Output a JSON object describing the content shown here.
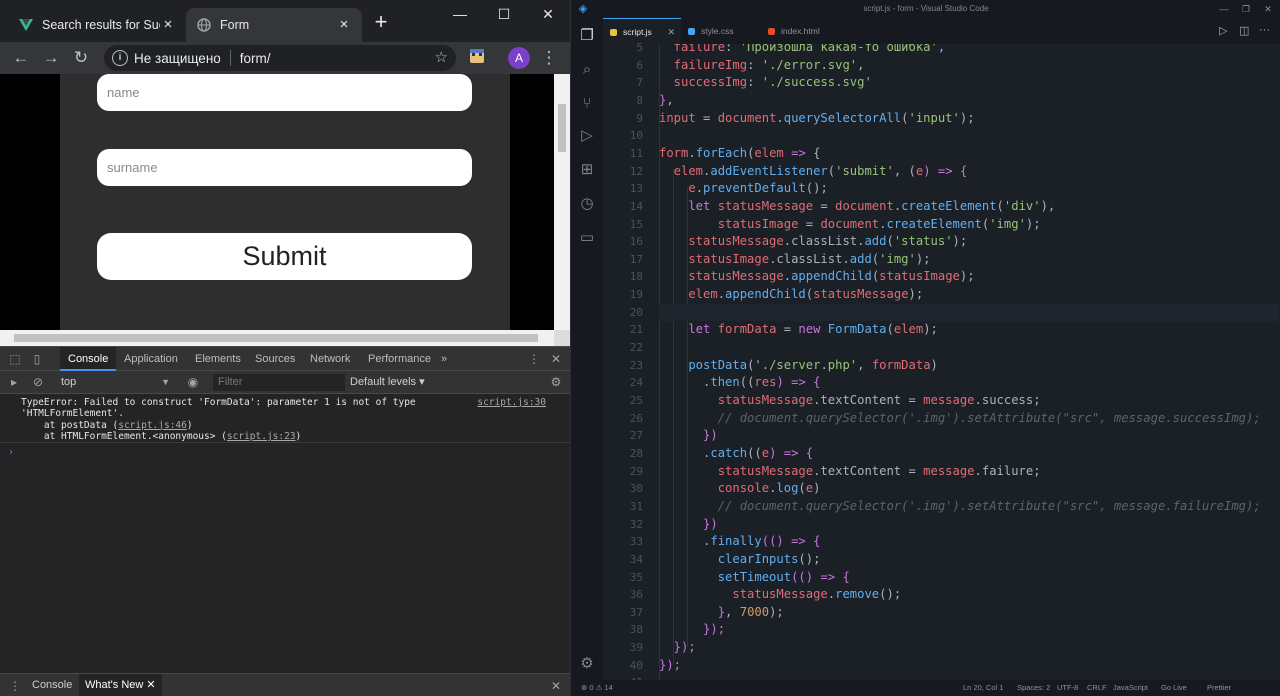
{
  "browser": {
    "tabs": [
      {
        "title": "Search results for Succe",
        "active": false,
        "favicon": "vue-logo-icon"
      },
      {
        "title": "Form",
        "active": true,
        "favicon": "globe-icon"
      }
    ],
    "new_tab": "+",
    "window": {
      "minimize": "—",
      "maximize": "☐",
      "close": "✕"
    },
    "address": {
      "security": "Не защищено",
      "url": "form/"
    },
    "avatar_letter": "A",
    "page": {
      "name_placeholder": "name",
      "surname_placeholder": "surname",
      "submit_label": "Submit"
    }
  },
  "devtools": {
    "tabs": [
      "Console",
      "Application",
      "Elements",
      "Sources",
      "Network",
      "Performance"
    ],
    "more": "»",
    "context": "top",
    "filter_placeholder": "Filter",
    "levels": "Default levels ▾",
    "error": {
      "line1": "TypeError: Failed to construct 'FormData': parameter 1 is not of type",
      "line2": "'HTMLFormElement'.",
      "line3_prefix": "    at postData (",
      "line3_link": "script.js:46",
      "line3_suffix": ")",
      "line4_prefix": "    at HTMLFormElement.<anonymous> (",
      "line4_link": "script.js:23",
      "line4_suffix": ")",
      "source": "script.js:30"
    },
    "prompt": "›",
    "drawer_tabs": [
      "Console",
      "What's New"
    ]
  },
  "vscode": {
    "title": "script.js - form - Visual Studio Code",
    "tabs": [
      {
        "name": "script.js",
        "color": "#e8c33a",
        "active": true
      },
      {
        "name": "style.css",
        "color": "#42a5f5",
        "active": false
      },
      {
        "name": "index.html",
        "color": "#e44d26",
        "active": false
      }
    ],
    "first_line_number": 5,
    "code_lines": [
      [
        [
          "  failure",
          "t-var"
        ],
        [
          ": ",
          "t-pun"
        ],
        [
          "'Произошла какая-то ошибка'",
          "t-str"
        ],
        [
          ",",
          "t-pun"
        ]
      ],
      [
        [
          "  failureImg",
          "t-var"
        ],
        [
          ": ",
          "t-pun"
        ],
        [
          "'./error.svg'",
          "t-str"
        ],
        [
          ",",
          "t-pun"
        ]
      ],
      [
        [
          "  successImg",
          "t-var"
        ],
        [
          ": ",
          "t-pun"
        ],
        [
          "'./success.svg'",
          "t-str"
        ]
      ],
      [
        [
          "}",
          "t-kw"
        ],
        [
          ",",
          "t-pun"
        ]
      ],
      [
        [
          "input",
          "t-var"
        ],
        [
          " = ",
          "t-pun"
        ],
        [
          "document",
          "t-var"
        ],
        [
          ".",
          "t-pun"
        ],
        [
          "querySelectorAll",
          "t-fn"
        ],
        [
          "(",
          "t-pun"
        ],
        [
          "'input'",
          "t-str"
        ],
        [
          ");",
          "t-pun"
        ]
      ],
      [],
      [
        [
          "form",
          "t-var"
        ],
        [
          ".",
          "t-pun"
        ],
        [
          "forEach",
          "t-fn"
        ],
        [
          "(",
          "t-pun"
        ],
        [
          "elem",
          "t-var"
        ],
        [
          " => ",
          "t-kw"
        ],
        [
          "{",
          "t-pun"
        ]
      ],
      [
        [
          "  elem",
          "t-var"
        ],
        [
          ".",
          "t-pun"
        ],
        [
          "addEventListener",
          "t-fn"
        ],
        [
          "(",
          "t-pun"
        ],
        [
          "'submit'",
          "t-str"
        ],
        [
          ", (",
          "t-pun"
        ],
        [
          "e",
          "t-var"
        ],
        [
          ") => {",
          "t-kw"
        ]
      ],
      [
        [
          "    e",
          "t-var"
        ],
        [
          ".",
          "t-pun"
        ],
        [
          "preventDefault",
          "t-fn"
        ],
        [
          "();",
          "t-pun"
        ]
      ],
      [
        [
          "    let ",
          "t-kw"
        ],
        [
          "statusMessage",
          "t-var"
        ],
        [
          " = ",
          "t-pun"
        ],
        [
          "document",
          "t-var"
        ],
        [
          ".",
          "t-pun"
        ],
        [
          "createElement",
          "t-fn"
        ],
        [
          "(",
          "t-pun"
        ],
        [
          "'div'",
          "t-str"
        ],
        [
          "),",
          "t-pun"
        ]
      ],
      [
        [
          "        statusImage",
          "t-var"
        ],
        [
          " = ",
          "t-pun"
        ],
        [
          "document",
          "t-var"
        ],
        [
          ".",
          "t-pun"
        ],
        [
          "createElement",
          "t-fn"
        ],
        [
          "(",
          "t-pun"
        ],
        [
          "'img'",
          "t-str"
        ],
        [
          ");",
          "t-pun"
        ]
      ],
      [
        [
          "    statusMessage",
          "t-var"
        ],
        [
          ".classList.",
          "t-pun"
        ],
        [
          "add",
          "t-fn"
        ],
        [
          "(",
          "t-pun"
        ],
        [
          "'status'",
          "t-str"
        ],
        [
          ");",
          "t-pun"
        ]
      ],
      [
        [
          "    statusImage",
          "t-var"
        ],
        [
          ".classList.",
          "t-pun"
        ],
        [
          "add",
          "t-fn"
        ],
        [
          "(",
          "t-pun"
        ],
        [
          "'img'",
          "t-str"
        ],
        [
          ");",
          "t-pun"
        ]
      ],
      [
        [
          "    statusMessage",
          "t-var"
        ],
        [
          ".",
          "t-pun"
        ],
        [
          "appendChild",
          "t-fn"
        ],
        [
          "(",
          "t-pun"
        ],
        [
          "statusImage",
          "t-var"
        ],
        [
          ");",
          "t-pun"
        ]
      ],
      [
        [
          "    elem",
          "t-var"
        ],
        [
          ".",
          "t-pun"
        ],
        [
          "appendChild",
          "t-fn"
        ],
        [
          "(",
          "t-pun"
        ],
        [
          "statusMessage",
          "t-var"
        ],
        [
          ");",
          "t-pun"
        ]
      ],
      [],
      [
        [
          "    let ",
          "t-kw"
        ],
        [
          "formData",
          "t-var"
        ],
        [
          " = ",
          "t-pun"
        ],
        [
          "new ",
          "t-kw"
        ],
        [
          "FormData",
          "t-fn"
        ],
        [
          "(",
          "t-pun"
        ],
        [
          "elem",
          "t-var"
        ],
        [
          ");",
          "t-pun"
        ]
      ],
      [],
      [
        [
          "    postData",
          "t-fn"
        ],
        [
          "(",
          "t-pun"
        ],
        [
          "'./server.php'",
          "t-str"
        ],
        [
          ", ",
          "t-pun"
        ],
        [
          "formData",
          "t-var"
        ],
        [
          ")",
          "t-pun"
        ]
      ],
      [
        [
          "      .",
          "t-pun"
        ],
        [
          "then",
          "t-fn"
        ],
        [
          "((",
          "t-pun"
        ],
        [
          "res",
          "t-var"
        ],
        [
          ") => {",
          "t-kw"
        ]
      ],
      [
        [
          "        statusMessage",
          "t-var"
        ],
        [
          ".textContent = ",
          "t-pun"
        ],
        [
          "message",
          "t-var"
        ],
        [
          ".success;",
          "t-pun"
        ]
      ],
      [
        [
          "        // document.querySelector('.img').setAttribute(\"src\", message.successImg);",
          "t-cmt"
        ]
      ],
      [
        [
          "      })",
          "t-kw"
        ]
      ],
      [
        [
          "      .",
          "t-pun"
        ],
        [
          "catch",
          "t-fn"
        ],
        [
          "((",
          "t-pun"
        ],
        [
          "e",
          "t-var"
        ],
        [
          ") => {",
          "t-kw"
        ]
      ],
      [
        [
          "        statusMessage",
          "t-var"
        ],
        [
          ".textContent = ",
          "t-pun"
        ],
        [
          "message",
          "t-var"
        ],
        [
          ".failure;",
          "t-pun"
        ]
      ],
      [
        [
          "        console",
          "t-var"
        ],
        [
          ".",
          "t-pun"
        ],
        [
          "log",
          "t-fn"
        ],
        [
          "(",
          "t-pun"
        ],
        [
          "e",
          "t-var"
        ],
        [
          ")",
          "t-pun"
        ]
      ],
      [
        [
          "        // document.querySelector('.img').setAttribute(\"src\", message.failureImg);",
          "t-cmt"
        ]
      ],
      [
        [
          "      })",
          "t-kw"
        ]
      ],
      [
        [
          "      .",
          "t-pun"
        ],
        [
          "finally",
          "t-fn"
        ],
        [
          "(() => {",
          "t-kw"
        ]
      ],
      [
        [
          "        clearInputs",
          "t-fn"
        ],
        [
          "();",
          "t-pun"
        ]
      ],
      [
        [
          "        setTimeout",
          "t-fn"
        ],
        [
          "(() => {",
          "t-kw"
        ]
      ],
      [
        [
          "          statusMessage",
          "t-var"
        ],
        [
          ".",
          "t-pun"
        ],
        [
          "remove",
          "t-fn"
        ],
        [
          "();",
          "t-pun"
        ]
      ],
      [
        [
          "        }",
          "t-kw"
        ],
        [
          ", ",
          "t-pun"
        ],
        [
          "7000",
          "t-num"
        ],
        [
          ");",
          "t-pun"
        ]
      ],
      [
        [
          "      });",
          "t-kw"
        ]
      ],
      [
        [
          "  });",
          "t-kw"
        ]
      ],
      [
        [
          "});",
          "t-kw"
        ]
      ],
      []
    ],
    "status": {
      "problems": "⊗ 0 ⚠ 14",
      "position": "Ln 20, Col 1",
      "spaces": "Spaces: 2",
      "encoding": "UTF-8",
      "eol": "CRLF",
      "language": "JavaScript",
      "golive": "Go Live",
      "prettier": "Prettier"
    }
  }
}
